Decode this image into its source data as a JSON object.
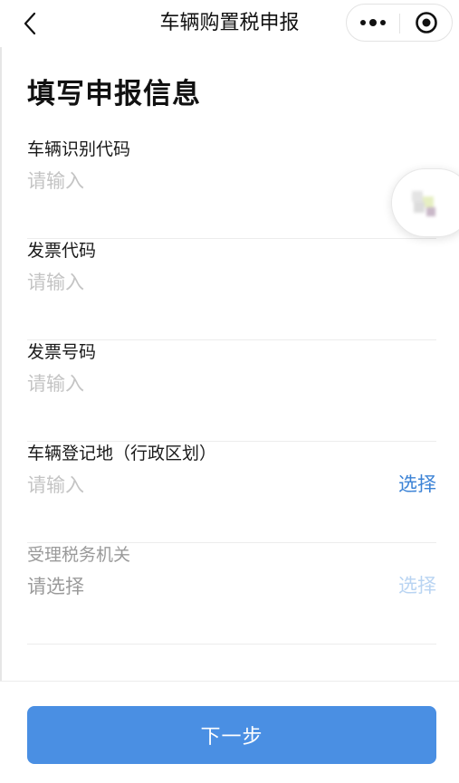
{
  "navbar": {
    "title": "车辆购置税申报"
  },
  "heading": "填写申报信息",
  "fields": [
    {
      "label": "车辆识别代码",
      "placeholder": "请输入"
    },
    {
      "label": "发票代码",
      "placeholder": "请输入"
    },
    {
      "label": "发票号码",
      "placeholder": "请输入"
    },
    {
      "label": "车辆登记地（行政区划）",
      "placeholder": "请输入",
      "action": "选择"
    },
    {
      "label": "受理税务机关",
      "placeholder": "请选择",
      "action": "选择"
    }
  ],
  "next_button": "下一步",
  "colors": {
    "accent": "#3c83d6",
    "button": "#4a8fe3",
    "placeholder": "#c4c4c4"
  }
}
